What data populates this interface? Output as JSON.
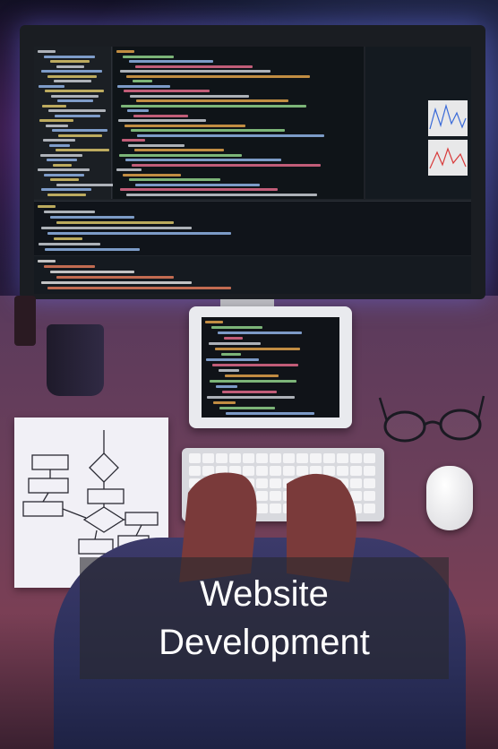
{
  "caption": {
    "line1": "Website",
    "line2": "Development"
  },
  "scene": {
    "description_icons": [
      "monitor-icon",
      "tablet-icon",
      "keyboard-icon",
      "mouse-icon",
      "flowchart-paper-icon",
      "mug-icon",
      "glasses-icon"
    ],
    "accent_colors": {
      "glow_blue": "#6e78ff",
      "glow_magenta": "#c83cc8",
      "caption_text": "#ffffff",
      "caption_bg": "#28282d"
    }
  }
}
